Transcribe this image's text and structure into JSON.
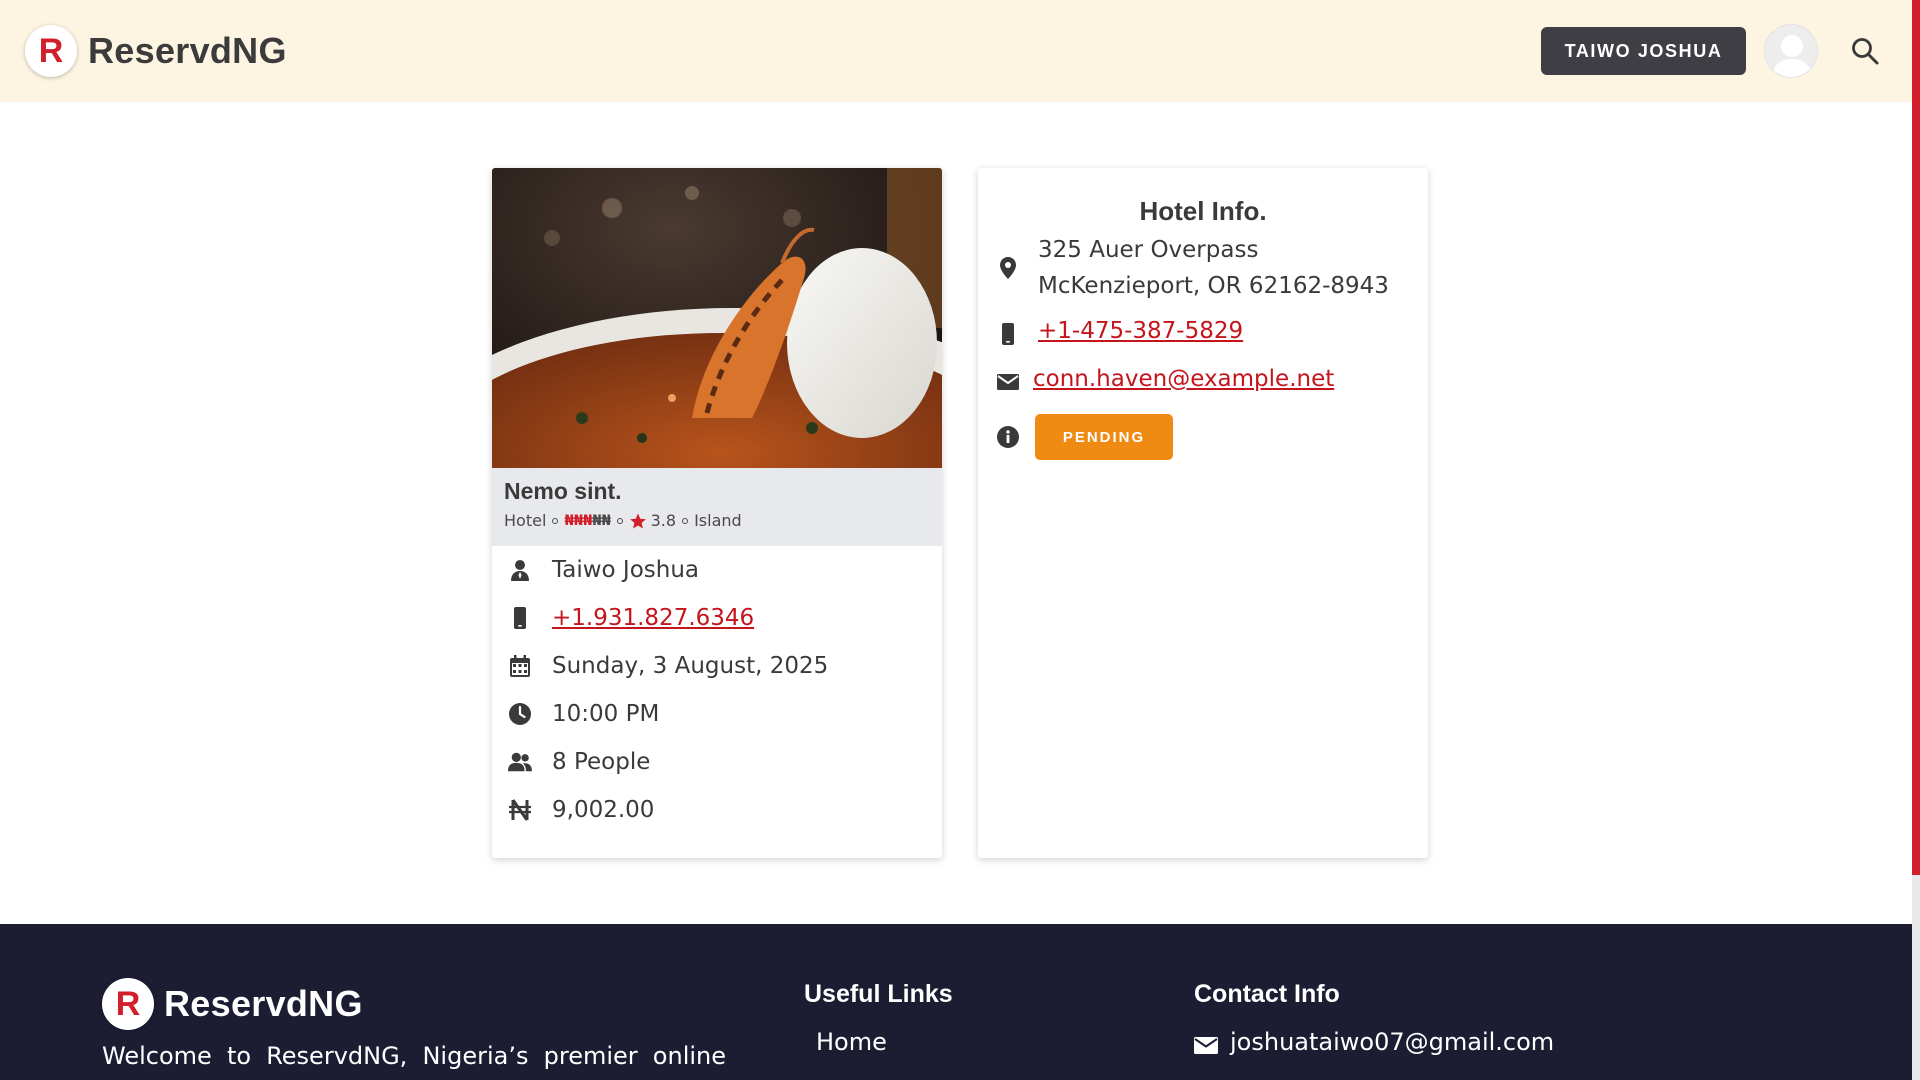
{
  "header": {
    "brand_letter": "R",
    "brand_name": "ReservdNG",
    "user_button": "TAIWO JOSHUA",
    "avatar_icon": "user-avatar-icon",
    "search_icon": "search-icon"
  },
  "booking": {
    "restaurant_name": "Nemo sint.",
    "type": "Hotel",
    "price_symbols": "₦₦₦₦₦",
    "price_level": 3,
    "price_max": 5,
    "rating": "3.8",
    "location": "Island",
    "customer_name": "Taiwo Joshua",
    "customer_phone": "+1.931.827.6346",
    "date": "Sunday, 3 August, 2025",
    "time": "10:00 PM",
    "party_size": "8 People",
    "amount": "9,002.00"
  },
  "hotel_info": {
    "title": "Hotel Info.",
    "address_line1": "325 Auer Overpass",
    "address_line2": "McKenzieport, OR 62162-8943",
    "phone": "+1-475-387-5829",
    "email": "conn.haven@example.net",
    "status": "PENDING"
  },
  "footer": {
    "brand_letter": "R",
    "brand_name": "ReservdNG",
    "description": "Welcome to ReservdNG, Nigeria’s premier online",
    "useful_links_title": "Useful Links",
    "useful_links": [
      "Home"
    ],
    "contact_title": "Contact Info",
    "contact_email": "joshuataiwo07@gmail.com"
  },
  "colors": {
    "header_bg": "#fdf4e1",
    "accent_red": "#d11f2c",
    "status_orange": "#ef8a12",
    "footer_bg": "#1c1d33",
    "dark_button": "#3f3e44"
  }
}
